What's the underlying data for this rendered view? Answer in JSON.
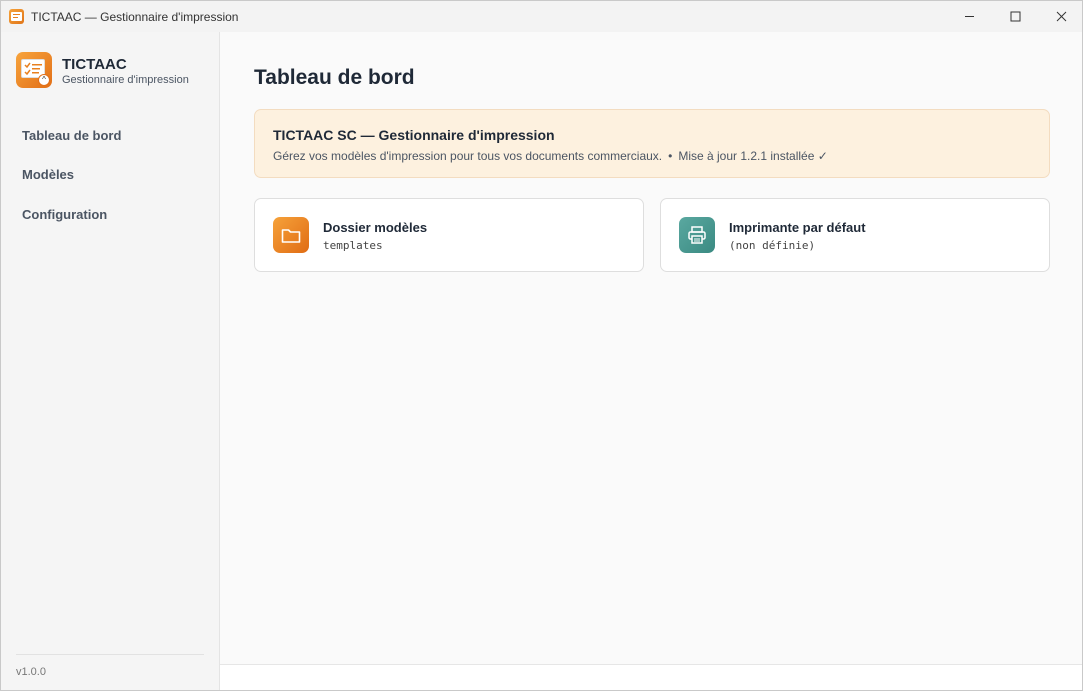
{
  "window": {
    "title": "TICTAAC — Gestionnaire d'impression",
    "controls": {
      "minimize": "—",
      "maximize": "☐",
      "close": "✕"
    }
  },
  "sidebar": {
    "brand_name": "TICTAAC",
    "brand_subtitle": "Gestionnaire d'impression",
    "items": [
      {
        "label": "Tableau de bord"
      },
      {
        "label": "Modèles"
      },
      {
        "label": "Configuration"
      }
    ],
    "version": "v1.0.0"
  },
  "main": {
    "page_title": "Tableau de bord",
    "banner": {
      "title": "TICTAAC SC — Gestionnaire d'impression",
      "description": "Gérez vos modèles d'impression pour tous vos documents commerciaux.",
      "separator": "•",
      "update_status": "Mise à jour 1.2.1 installée ✓"
    },
    "cards": [
      {
        "title": "Dossier modèles",
        "value": "templates",
        "icon": "folder-icon"
      },
      {
        "title": "Imprimante par défaut",
        "value": "(non définie)",
        "icon": "printer-icon"
      }
    ]
  },
  "colors": {
    "accent_orange": "#e8801f",
    "accent_teal": "#3f9088",
    "banner_bg": "#fdf1df"
  }
}
